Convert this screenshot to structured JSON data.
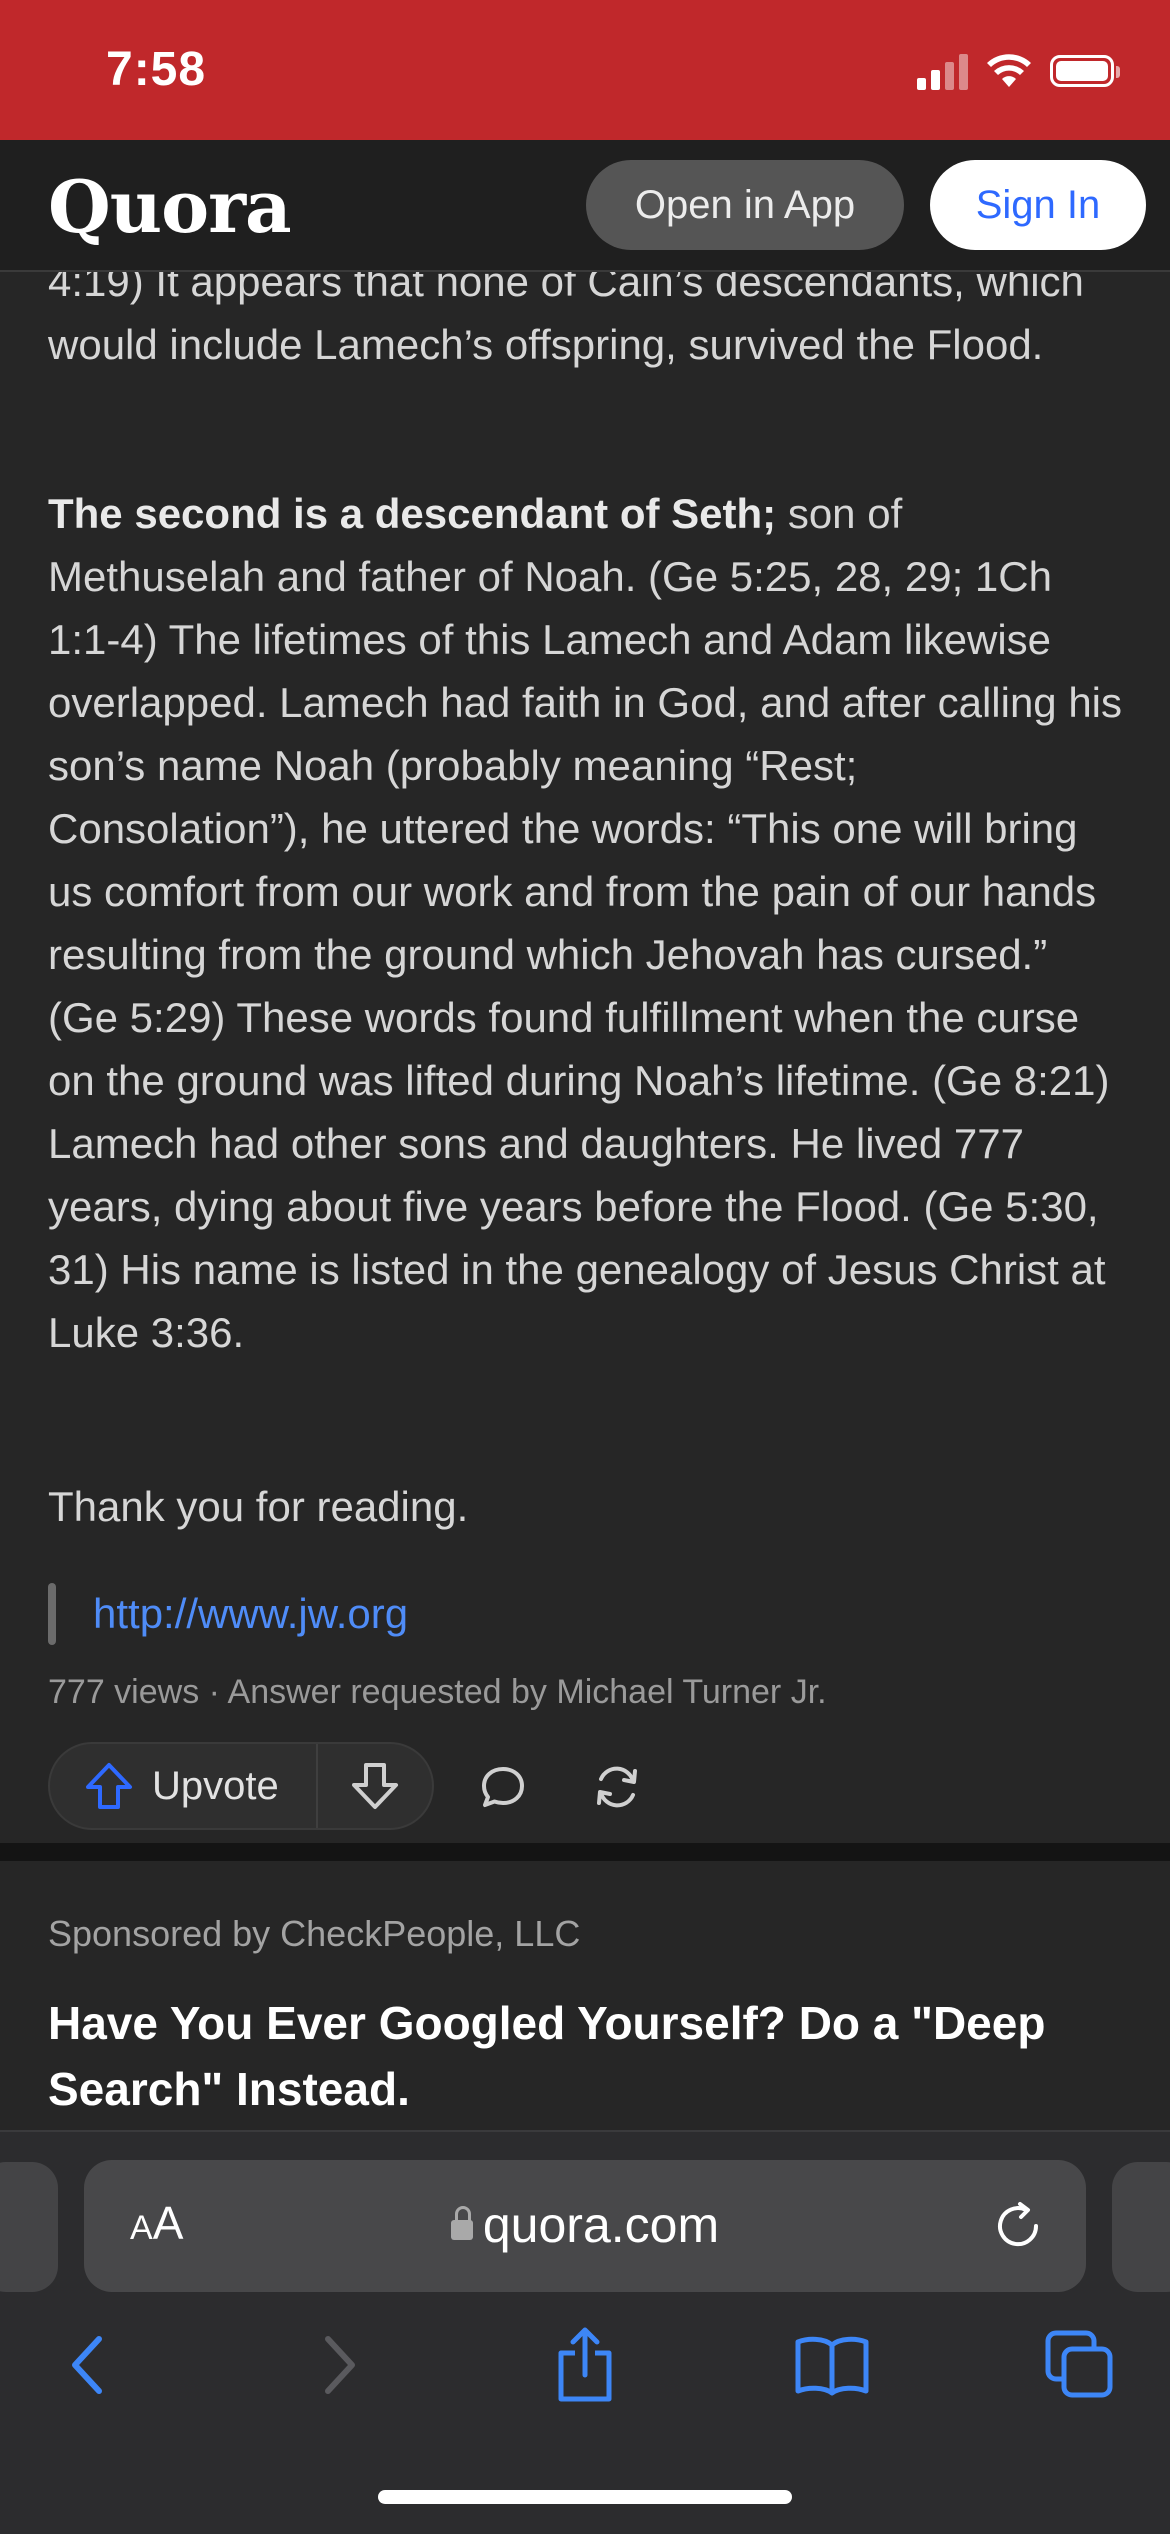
{
  "status_bar": {
    "time": "7:58"
  },
  "header": {
    "logo": "Quora",
    "open_in_app": "Open in App",
    "sign_in": "Sign In"
  },
  "answer": {
    "paragraph_1": "4:19) It appears that none of Cain’s descendants, which would include Lamech’s offspring, survived the Flood.",
    "paragraph_2_bold": "The second is a descendant of Seth;",
    "paragraph_2_rest": " son of Methuselah and father of Noah. (Ge 5:25, 28, 29; 1Ch 1:1-4) The lifetimes of this Lamech and Adam likewise overlapped. Lamech had faith in God, and after calling his son’s name Noah (probably meaning “Rest; Consolation”), he uttered the words: “This one will bring us comfort from our work and from the pain of our hands resulting from the ground which Jehovah has cursed.” (Ge 5:29) These words found fulfillment when the curse on the ground was lifted during Noah’s lifetime. (Ge 8:21) Lamech had other sons and daughters. He lived 777 years, dying about five years before the Flood. (Ge 5:30, 31) His name is listed in the genealogy of Jesus Christ at Luke 3:36.",
    "paragraph_3": "Thank you for reading.",
    "link": "http://www.jw.org",
    "meta": "777 views · Answer requested by Michael Turner Jr.",
    "upvote_label": "Upvote"
  },
  "sponsored": {
    "label": "Sponsored by CheckPeople, LLC",
    "title": "Have You Ever Googled Yourself? Do a \"Deep Search\" Instead."
  },
  "browser": {
    "text_size_small": "A",
    "text_size_large": "A",
    "url": "quora.com"
  },
  "colors": {
    "status_bar": "#c0282b",
    "accent_blue": "#2e69ff",
    "link_blue": "#4f8cf7",
    "background": "#262626"
  }
}
